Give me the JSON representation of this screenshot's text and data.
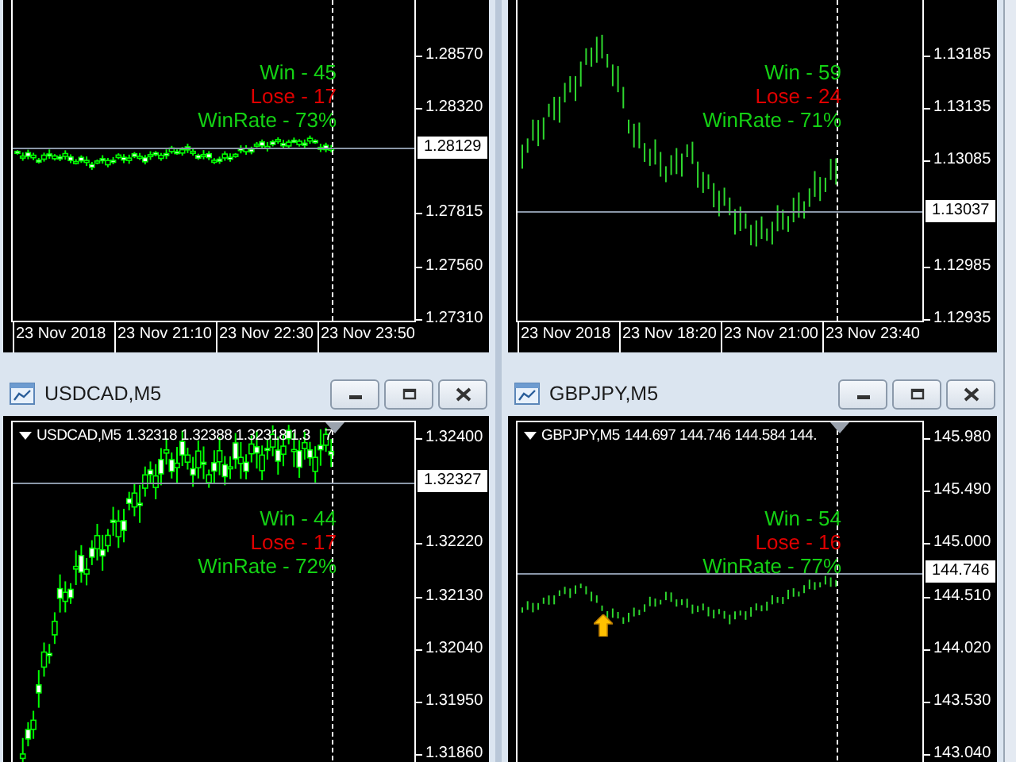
{
  "windows": [
    {
      "kind": "candles",
      "buy_arrow": false,
      "price_labels": [
        "1.28570",
        "1.28320",
        "1.27815",
        "1.27560",
        "1.27310"
      ],
      "current_price": "1.28129",
      "time_labels": [
        "23 Nov 2018",
        "23 Nov 21:10",
        "23 Nov 22:30",
        "23 Nov 23:50"
      ],
      "stats": {
        "win": "Win - 45",
        "lose": "Lose - 17",
        "winrate": "WinRate - 73%"
      }
    },
    {
      "kind": "bars",
      "buy_arrow": false,
      "price_labels": [
        "1.13185",
        "1.13135",
        "1.13085",
        "1.12985",
        "1.12935"
      ],
      "current_price": "1.13037",
      "time_labels": [
        "23 Nov 2018",
        "23 Nov 18:20",
        "23 Nov 21:00",
        "23 Nov 23:40"
      ],
      "stats": {
        "win": "Win - 59",
        "lose": "Lose - 24",
        "winrate": "WinRate - 71%"
      }
    },
    {
      "kind": "candles",
      "buy_arrow": false,
      "title": "USDCAD,M5",
      "header": {
        "symbol": "USDCAD,M5",
        "quote": "1.32318 1.32388 1.32318 1.3",
        "tail": "7"
      },
      "price_labels": [
        "1.32400",
        "1.32220",
        "1.32130",
        "1.32040",
        "1.31950",
        "1.31860"
      ],
      "current_price": "1.32327",
      "stats": {
        "win": "Win - 44",
        "lose": "Lose - 17",
        "winrate": "WinRate - 72%"
      }
    },
    {
      "kind": "bars",
      "buy_arrow": true,
      "title": "GBPJPY,M5",
      "header": {
        "symbol": "GBPJPY,M5",
        "quote": "144.697 144.746 144.584 144."
      },
      "price_labels": [
        "145.980",
        "145.490",
        "145.000",
        "144.510",
        "144.020",
        "143.530",
        "143.040"
      ],
      "current_price": "144.746",
      "stats": {
        "win": "Win - 54",
        "lose": "Lose - 16",
        "winrate": "WinRate - 77%"
      }
    }
  ]
}
